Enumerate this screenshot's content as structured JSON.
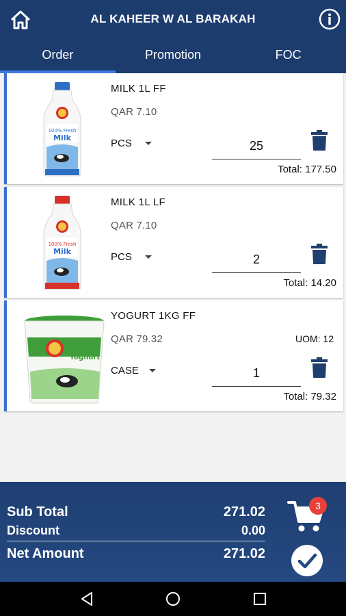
{
  "header": {
    "title": "AL KAHEER W AL BARAKAH",
    "home_icon": "home-icon",
    "info_icon": "info-icon"
  },
  "tabs": [
    {
      "label": "Order",
      "active": true
    },
    {
      "label": "Promotion",
      "active": false
    },
    {
      "label": "FOC",
      "active": false
    }
  ],
  "items": [
    {
      "name": "MILK 1L FF",
      "price": "QAR 7.10",
      "uom": "",
      "unit": "PCS",
      "qty": "25",
      "total": "Total: 177.50",
      "image": "milk-bottle-blue"
    },
    {
      "name": "MILK 1L LF",
      "price": "QAR 7.10",
      "uom": "",
      "unit": "PCS",
      "qty": "2",
      "total": "Total: 14.20",
      "image": "milk-bottle-red"
    },
    {
      "name": "YOGURT 1KG FF",
      "price": "QAR 79.32",
      "uom": "UOM: 12",
      "unit": "CASE",
      "qty": "1",
      "total": "Total: 79.32",
      "image": "yogurt-tub-green"
    }
  ],
  "summary": {
    "sub_total_label": "Sub Total",
    "sub_total": "271.02",
    "discount_label": "Discount",
    "discount": "0.00",
    "net_amount_label": "Net Amount",
    "net_amount": "271.02",
    "cart_count": "3"
  },
  "colors": {
    "header": "#1d3c6e",
    "accent": "#3f7be3",
    "badge": "#e8403a",
    "trash": "#1f3f6e"
  }
}
